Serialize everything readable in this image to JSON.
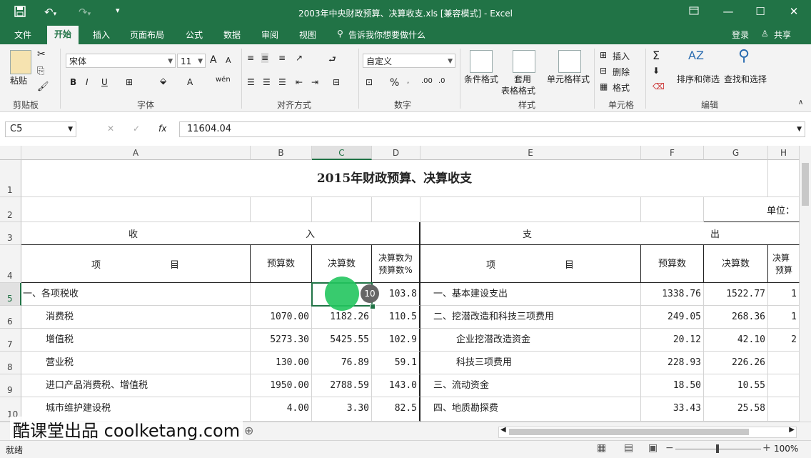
{
  "window": {
    "title": "2003年中央财政预算、决算收支.xls  [兼容模式] - Excel"
  },
  "tabs": [
    "文件",
    "开始",
    "插入",
    "页面布局",
    "公式",
    "数据",
    "审阅",
    "视图"
  ],
  "tell_me": "告诉我你想要做什么",
  "account": {
    "login": "登录",
    "share": "共享"
  },
  "ribbon": {
    "clipboard": {
      "paste": "粘贴",
      "label": "剪贴板"
    },
    "font": {
      "name": "宋体",
      "size": "11",
      "label": "字体",
      "bold": "B",
      "italic": "I",
      "underline": "U",
      "grow": "A",
      "shrink": "A",
      "color": "A"
    },
    "alignment": {
      "label": "对齐方式"
    },
    "number": {
      "format": "自定义",
      "label": "数字",
      "percent": "%"
    },
    "styles": {
      "conditional": "条件格式",
      "table1": "套用",
      "table2": "表格格式",
      "cell_style": "单元格样式",
      "label": "样式"
    },
    "cells": {
      "insert": "插入",
      "delete": "删除",
      "format": "格式",
      "label": "单元格"
    },
    "editing": {
      "sort": "排序和筛选",
      "find": "查找和选择",
      "label": "编辑"
    }
  },
  "formula_bar": {
    "name_box": "C5",
    "fx": "fx",
    "value": "11604.04"
  },
  "columns": [
    "A",
    "B",
    "C",
    "D",
    "E",
    "F",
    "G",
    "H"
  ],
  "rows": [
    "1",
    "2",
    "3",
    "4",
    "5",
    "6",
    "7",
    "8",
    "9",
    "10"
  ],
  "sheet": {
    "title": "2015年财政预算、决算收支",
    "unit": "单位：",
    "income": "收",
    "income2": "入",
    "expense": "支",
    "expense2": "出",
    "hdr_item": "项",
    "hdr_item2": "目",
    "hdr_budget": "预算数",
    "hdr_actual": "决算数",
    "hdr_pct1": "决算数为",
    "hdr_pct2": "预算数%",
    "hdr_pct_cut": "决算",
    "hdr_pct_cut2": "预算",
    "rows": [
      {
        "a": "一、各项税收",
        "b": "",
        "c": "",
        "d": "103.8",
        "e": "一、基本建设支出",
        "f": "1338.76",
        "g": "1522.77",
        "h": "1"
      },
      {
        "a": "消费税",
        "b": "1070.00",
        "c": "1182.26",
        "d": "110.5",
        "e": "二、挖潜改造和科技三项费用",
        "f": "249.05",
        "g": "268.36",
        "h": "1"
      },
      {
        "a": "增值税",
        "b": "5273.30",
        "c": "5425.55",
        "d": "102.9",
        "e": "企业挖潜改造资金",
        "f": "20.12",
        "g": "42.10",
        "h": "2"
      },
      {
        "a": "营业税",
        "b": "130.00",
        "c": "76.89",
        "d": "59.1",
        "e": "科技三项费用",
        "f": "228.93",
        "g": "226.26",
        "h": ""
      },
      {
        "a": "进口产品消费税、增值税",
        "b": "1950.00",
        "c": "2788.59",
        "d": "143.0",
        "e": "三、流动资金",
        "f": "18.50",
        "g": "10.55",
        "h": ""
      },
      {
        "a": "城市维护建设税",
        "b": "4.00",
        "c": "3.30",
        "d": "82.5",
        "e": "四、地质勘探费",
        "f": "33.43",
        "g": "25.58",
        "h": ""
      }
    ]
  },
  "cursor_badge": "10",
  "watermark": "酷课堂出品 coolketang.com",
  "status": {
    "ready": "就绪",
    "zoom": "100%",
    "minus": "−",
    "plus": "+"
  },
  "colors": {
    "excel_green": "#217346",
    "selection": "#217346",
    "click_marker": "#22c55e"
  }
}
